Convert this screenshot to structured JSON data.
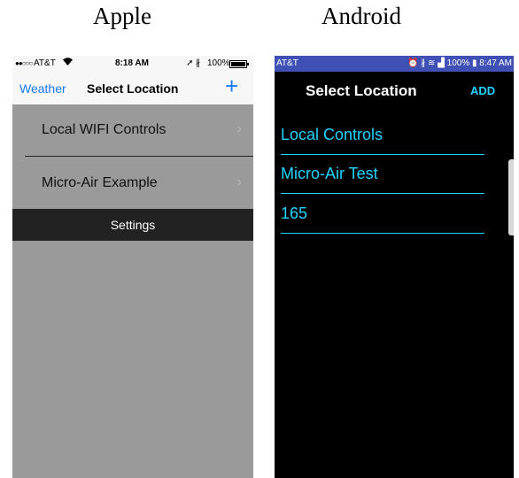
{
  "headings": {
    "apple": "Apple",
    "android": "Android"
  },
  "ios": {
    "statusbar": {
      "signal": "●●○○○",
      "carrier": "AT&T",
      "wifi_icon": "wifi-icon",
      "time": "8:18 AM",
      "location_icon": "➚",
      "bluetooth_icon": "∦",
      "battery": "100%"
    },
    "navbar": {
      "back": "Weather",
      "title": "Select Location",
      "add": "+"
    },
    "rows": [
      {
        "label": "Local WIFI Controls",
        "chevron": "›"
      },
      {
        "label": "Micro-Air Example",
        "chevron": "›"
      }
    ],
    "settings": "Settings",
    "colors": {
      "accent": "#1a7cf5",
      "background": "#9a9a9a",
      "settings_bar": "#222222"
    }
  },
  "android": {
    "statusbar": {
      "carrier": "AT&T",
      "icons": "⏰ ∦ ≋ ▟ 100% ▮ 8:47 AM"
    },
    "title": "Select Location",
    "add": "ADD",
    "items": [
      "Local Controls",
      "Micro-Air Test",
      "165"
    ],
    "colors": {
      "accent": "#22d3ff",
      "statusbar": "#3f51b5",
      "background": "#000000"
    }
  }
}
